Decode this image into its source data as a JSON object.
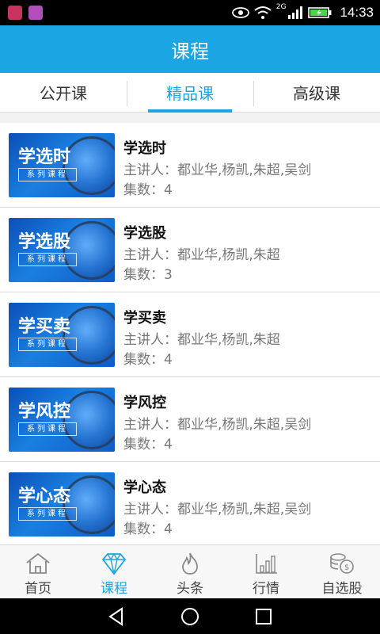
{
  "status_bar": {
    "time": "14:33",
    "network": "2G",
    "icons": [
      "notification-icon",
      "gallery-notification-icon",
      "eye-icon",
      "wifi-icon",
      "signal-icon",
      "battery-icon"
    ]
  },
  "header": {
    "title": "课程"
  },
  "tabs": [
    {
      "label": "公开课"
    },
    {
      "label": "精品课",
      "active": true
    },
    {
      "label": "高级课"
    }
  ],
  "courses": [
    {
      "thumb_title": "学选时",
      "thumb_sub": "系列课程",
      "title": "学选时",
      "lecturers": "主讲人：都业华,杨凯,朱超,吴剑",
      "episodes": "集数：4"
    },
    {
      "thumb_title": "学选股",
      "thumb_sub": "系列课程",
      "title": "学选股",
      "lecturers": "主讲人：都业华,杨凯,朱超",
      "episodes": "集数：3"
    },
    {
      "thumb_title": "学买卖",
      "thumb_sub": "系列课程",
      "title": "学买卖",
      "lecturers": "主讲人：都业华,杨凯,朱超",
      "episodes": "集数：4"
    },
    {
      "thumb_title": "学风控",
      "thumb_sub": "系列课程",
      "title": "学风控",
      "lecturers": "主讲人：都业华,杨凯,朱超,吴剑",
      "episodes": "集数：4"
    },
    {
      "thumb_title": "学心态",
      "thumb_sub": "系列课程",
      "title": "学心态",
      "lecturers": "主讲人：都业华,杨凯,朱超,吴剑",
      "episodes": "集数：4"
    }
  ],
  "bottom_nav": [
    {
      "label": "首页",
      "icon": "home-icon"
    },
    {
      "label": "课程",
      "icon": "diamond-icon",
      "active": true
    },
    {
      "label": "头条",
      "icon": "flame-icon"
    },
    {
      "label": "行情",
      "icon": "bar-chart-icon"
    },
    {
      "label": "自选股",
      "icon": "coins-icon"
    }
  ],
  "colors": {
    "accent": "#1ba6e3",
    "status_bar": "#000000"
  }
}
